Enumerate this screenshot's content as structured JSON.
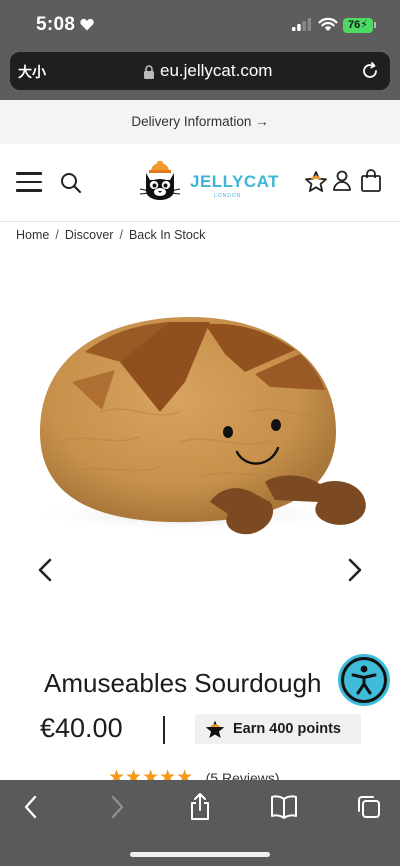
{
  "status": {
    "time": "5:08",
    "battery": "76"
  },
  "browser": {
    "text_size_label": "大小",
    "url": "eu.jellycat.com"
  },
  "banner": {
    "delivery_text": "Delivery Information →"
  },
  "header": {
    "logo_text": "JELLYCAT",
    "logo_sub": "LONDON"
  },
  "breadcrumb": {
    "items": [
      "Home",
      "Discover",
      "Back In Stock"
    ]
  },
  "product": {
    "title": "Amuseables Sourdough",
    "price": "€40.00",
    "points_text": "Earn 400 points",
    "rating": "5",
    "reviews_label": "(5 Reviews)"
  },
  "colors": {
    "accent": "#3cb5d6",
    "star": "#f4991a"
  }
}
